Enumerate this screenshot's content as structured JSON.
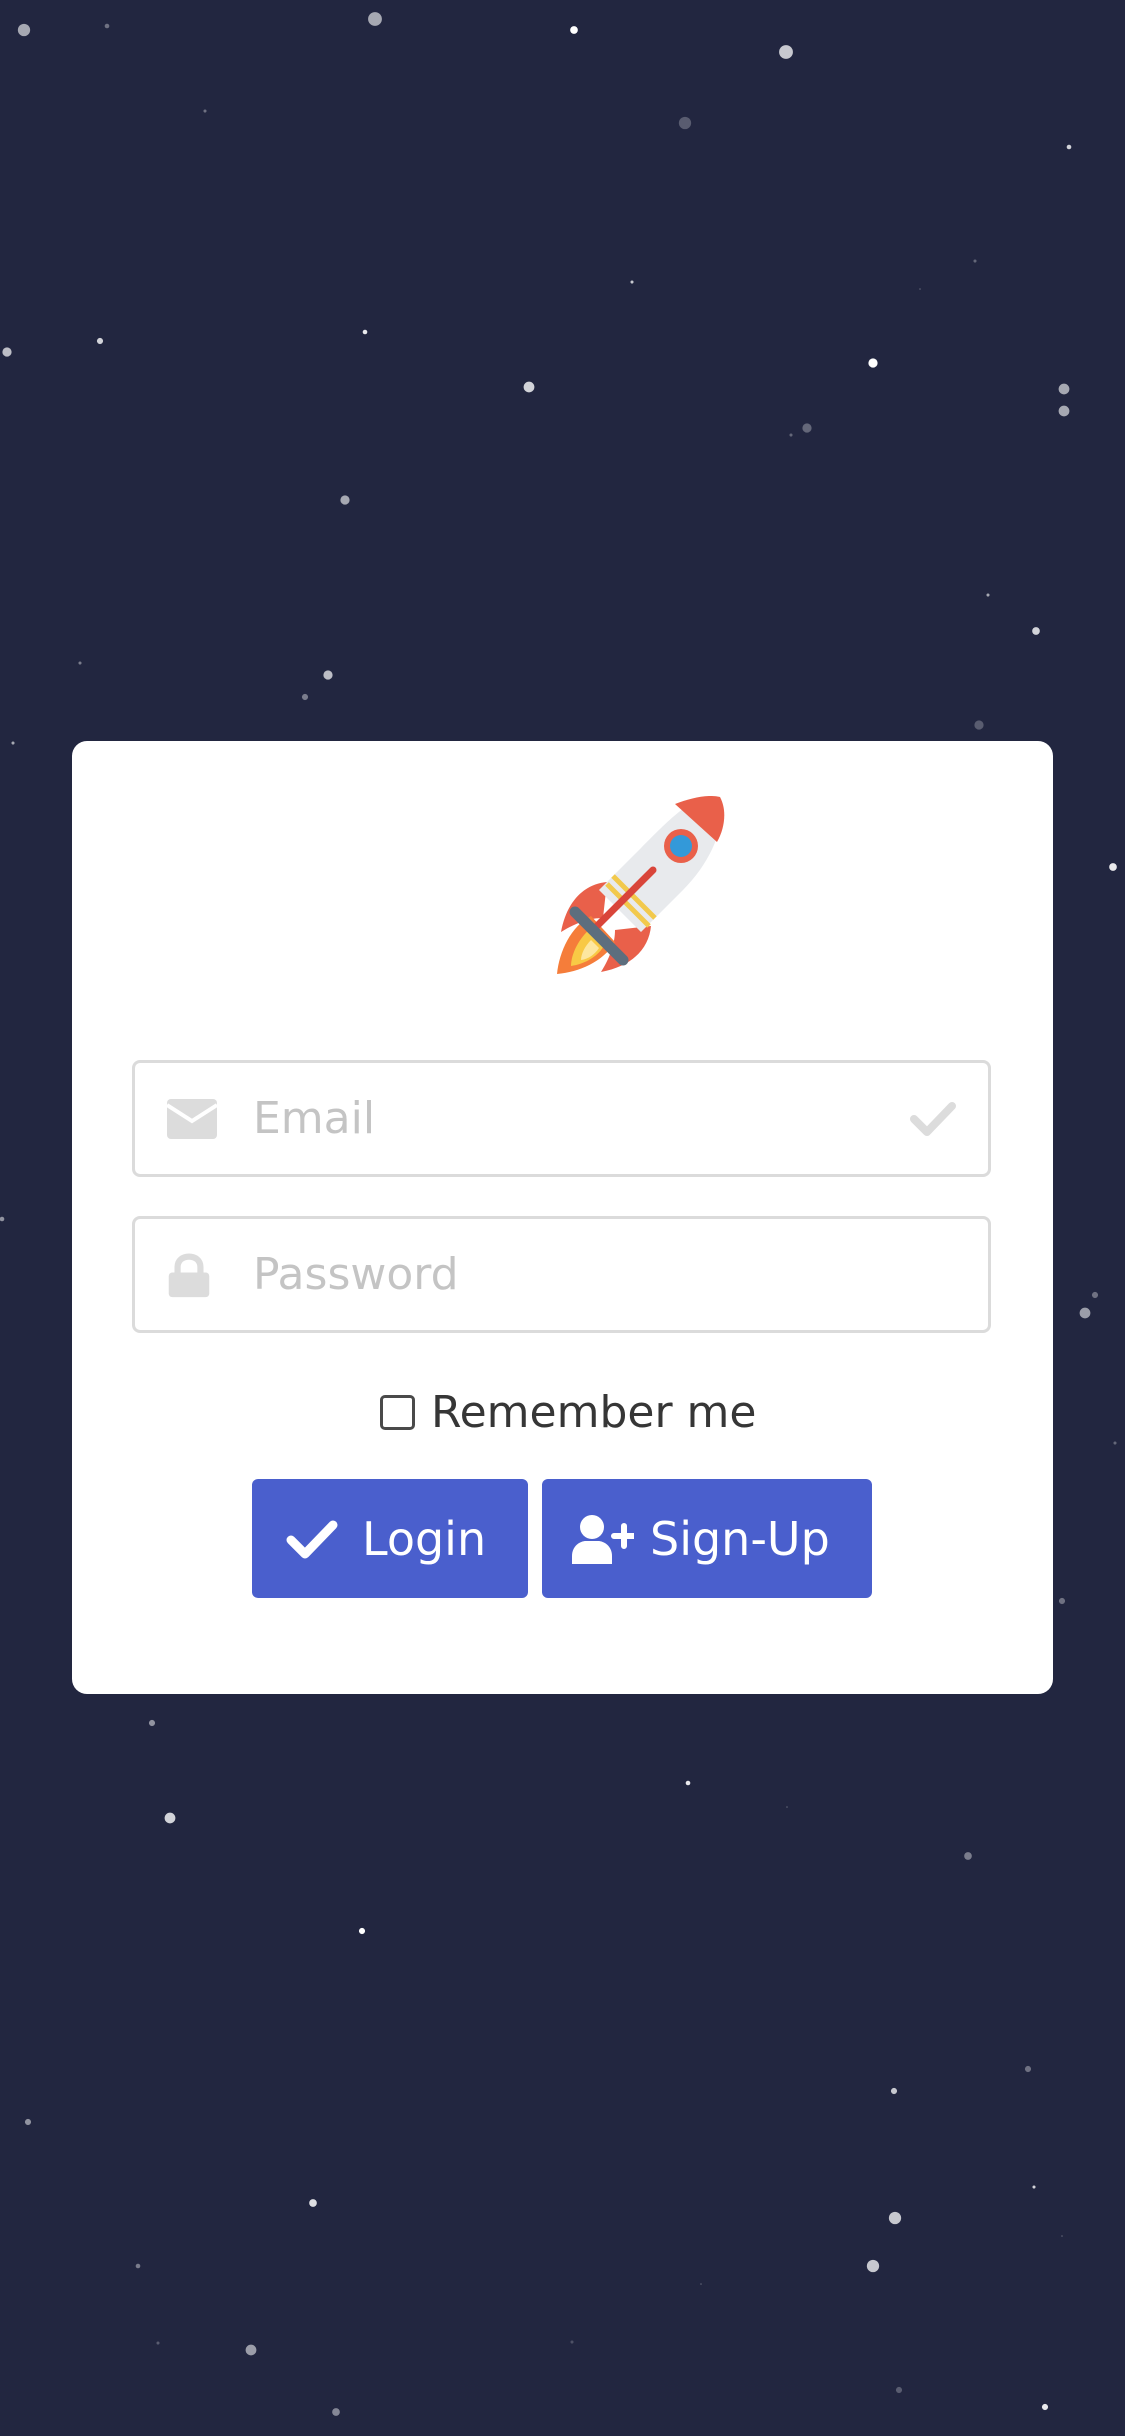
{
  "colors": {
    "background": "#222640",
    "card": "#ffffff",
    "accent": "#4a5fcd",
    "input_border": "#dbdbdb",
    "placeholder": "#c4c4c4",
    "icon_muted": "#dcdcdc"
  },
  "logo": {
    "icon": "rocket-icon"
  },
  "login_form": {
    "email": {
      "value": "",
      "placeholder": "Email",
      "left_icon": "envelope-icon",
      "right_icon": "checkmark-icon"
    },
    "password": {
      "value": "",
      "placeholder": "Password",
      "left_icon": "lock-icon"
    },
    "remember": {
      "label": "Remember me",
      "checked": false
    },
    "login_button": {
      "label": "Login",
      "icon": "checkmark-icon"
    },
    "signup_button": {
      "label": "Sign-Up",
      "icon": "user-plus-icon"
    }
  }
}
